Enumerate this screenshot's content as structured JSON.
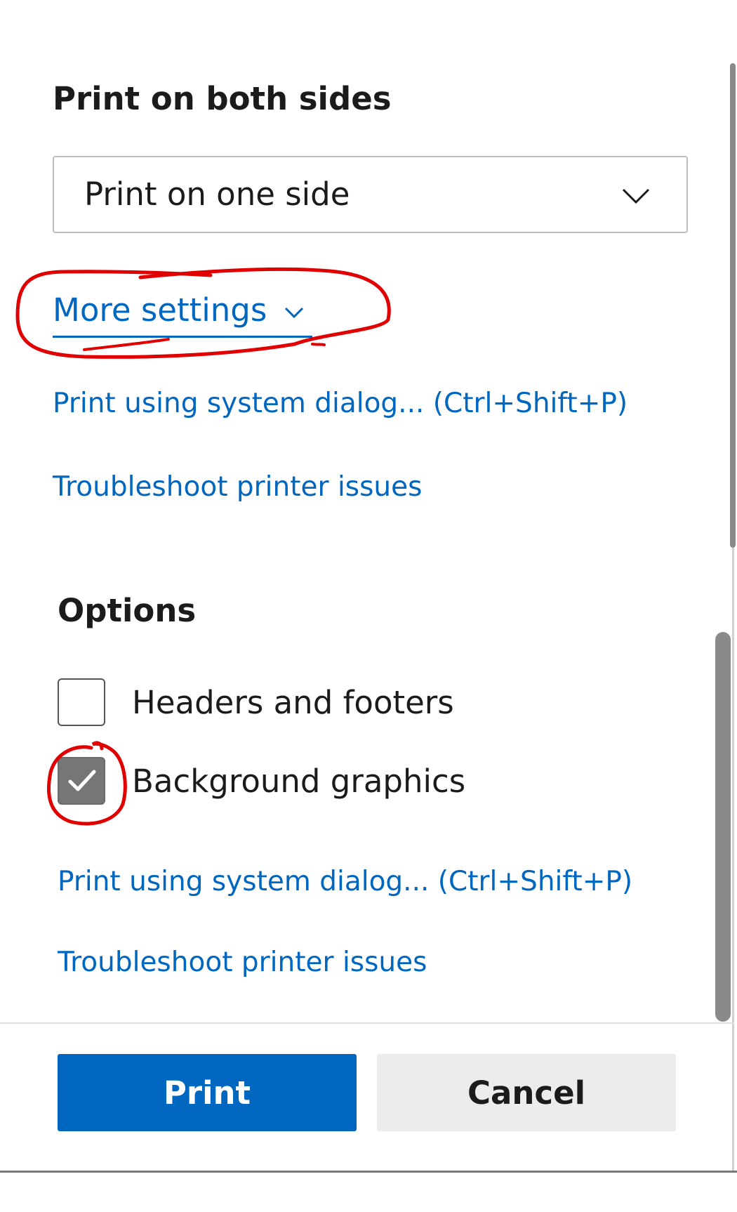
{
  "duplex": {
    "heading": "Print on both sides",
    "selected_value": "Print on one side"
  },
  "more_settings": {
    "label": "More settings"
  },
  "links_top": {
    "system_dialog": "Print using system dialog... (Ctrl+Shift+P)",
    "troubleshoot": "Troubleshoot printer issues"
  },
  "options": {
    "heading": "Options",
    "items": [
      {
        "label": "Headers and footers",
        "checked": false
      },
      {
        "label": "Background graphics",
        "checked": true
      }
    ]
  },
  "links_bottom": {
    "system_dialog": "Print using system dialog... (Ctrl+Shift+P)",
    "troubleshoot": "Troubleshoot printer issues"
  },
  "footer": {
    "print_label": "Print",
    "cancel_label": "Cancel"
  },
  "colors": {
    "accent": "#0067c0",
    "annotation": "#e00000",
    "checkbox_checked": "#767676"
  },
  "icons": {
    "dropdown": "chevron-down-icon",
    "more_settings": "chevron-down-icon",
    "checkmark": "checkmark-icon"
  }
}
